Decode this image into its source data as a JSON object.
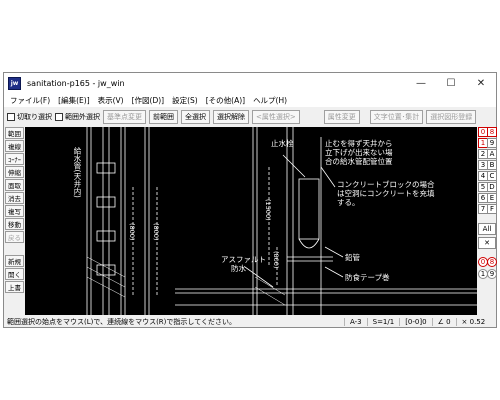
{
  "window": {
    "title": "sanitation-p165 - jw_win",
    "icon_text": "jw",
    "controls": {
      "minimize": "—",
      "maximize": "☐",
      "close": "✕"
    }
  },
  "menu": [
    "ファイル(F)",
    "[編集(E)]",
    "表示(V)",
    "[作図(D)]",
    "設定(S)",
    "[その他(A)]",
    "ヘルプ(H)"
  ],
  "toolbar": {
    "chk_cut": "切取り選択",
    "chk_outside": "範囲外選択",
    "base_point": "基準点変更",
    "prev_range": "前範囲",
    "select_all": "全選択",
    "cancel_select": "選択解除",
    "attr_select": "<属性選択>",
    "attr_change": "属性変更",
    "text_pos": "文字位置･集計",
    "register": "選択図形登録"
  },
  "left_tools": [
    {
      "label": "範囲",
      "enabled": true
    },
    {
      "label": "複線",
      "enabled": true
    },
    {
      "label": "ｺｰﾅｰ",
      "enabled": true
    },
    {
      "label": "伸縮",
      "enabled": true
    },
    {
      "label": "面取",
      "enabled": true
    },
    {
      "label": "消去",
      "enabled": true
    },
    {
      "label": "複写",
      "enabled": true
    },
    {
      "label": "移動",
      "enabled": true
    },
    {
      "label": "戻る",
      "enabled": false
    },
    {
      "label": "新規",
      "enabled": true
    },
    {
      "label": "開く",
      "enabled": true
    },
    {
      "label": "上書",
      "enabled": true
    }
  ],
  "right_tools": {
    "layer_groups": [
      "0",
      "1",
      "2",
      "3",
      "4",
      "5",
      "6",
      "7"
    ],
    "layers_right": [
      "8",
      "9",
      "A",
      "B",
      "C",
      "D",
      "E",
      "F"
    ],
    "all_label": "All",
    "x_label": "✕",
    "circle_top": [
      "0",
      "8"
    ],
    "circle_bottom": [
      "1",
      "9"
    ]
  },
  "drawing": {
    "notes": {
      "stop_valve": "止水栓",
      "ceiling_note_1": "止むを得ず天井から",
      "ceiling_note_2": "立下げが出来ない場",
      "ceiling_note_3": "合の給水管配管位置",
      "block_note_1": "コンクリートブロックの場合",
      "block_note_2": "は空洞にコンクリートを充填",
      "block_note_3": "する。",
      "lead_pipe": "鉛管",
      "asphalt_1": "アスファルト",
      "asphalt_2": "防水",
      "anticorrosion_tape": "防食テープ巻",
      "water_pipe_vertical": "給水管(天井内)",
      "dim_800_left": "(800)",
      "dim_800_right": "(800)",
      "dim_1500": "(1500)",
      "dim_800_mid": "(800)"
    }
  },
  "status": {
    "message": "範囲選択の始点をマウス(L)で、連続線をマウス(R)で指示してください。",
    "paper": "A-3",
    "scale": "S=1/1",
    "layer": "[0-0]0",
    "angle": "∠ 0",
    "zoom": "× 0.52"
  }
}
